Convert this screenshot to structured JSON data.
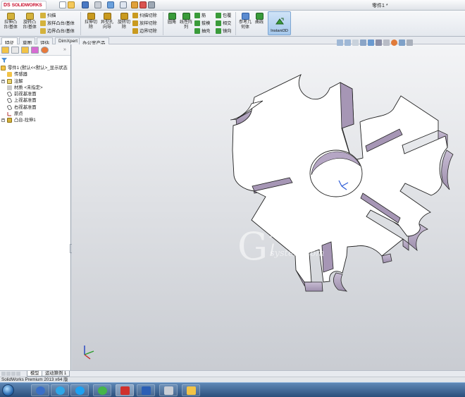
{
  "title_bar": {
    "logo_text": "SOLIDWORKS",
    "document_title": "零件1 *"
  },
  "ribbon": {
    "buttons": {
      "extrude_boss": "拉伸凸台/基体",
      "revolve_boss": "旋转凸台/基体",
      "sweep": "扫描",
      "loft_boss": "放样凸台/基体",
      "boundary_boss": "边界凸台/基体",
      "extrude_cut": "拉伸切除",
      "hole_wizard": "异型孔向导",
      "revolve_cut": "旋转切除",
      "swept_cut": "扫描切除",
      "lofted_cut": "放样切除",
      "boundary_cut": "边界切除",
      "fillet": "圆角",
      "linear_pattern": "线性阵列",
      "rib": "筋",
      "draft": "拔模",
      "shell": "抽壳",
      "wrap": "包覆",
      "intersect": "相交",
      "mirror": "镜向",
      "reference_geometry": "参考几何体",
      "curves": "曲线",
      "instant3d": "Instant3D"
    }
  },
  "tabs": [
    "特征",
    "草图",
    "评估",
    "DimXpert",
    "办公室产品"
  ],
  "feature_tree": {
    "root": "零件1 (默认<<默认>_显示状态",
    "items": [
      "传感器",
      "注解",
      "材质 <未指定>",
      "前视基准面",
      "上视基准面",
      "右视基准面",
      "原点",
      "凸台-拉伸1"
    ]
  },
  "watermark": {
    "letter": "G",
    "xi": "X I",
    "system": "system.com"
  },
  "bottom_tabs": [
    "模型",
    "运动算例 1"
  ],
  "status_bar": {
    "text": "SolidWorks Premium 2013 x64 版"
  },
  "colors": {
    "ribbon_bg": "#eef1f5",
    "viewport_top": "#f3f4f6",
    "viewport_bottom": "#c9ccd2",
    "part_face": "#ffffff",
    "part_side": "#b7a9c4",
    "taskbar": "#2b4f7c"
  }
}
